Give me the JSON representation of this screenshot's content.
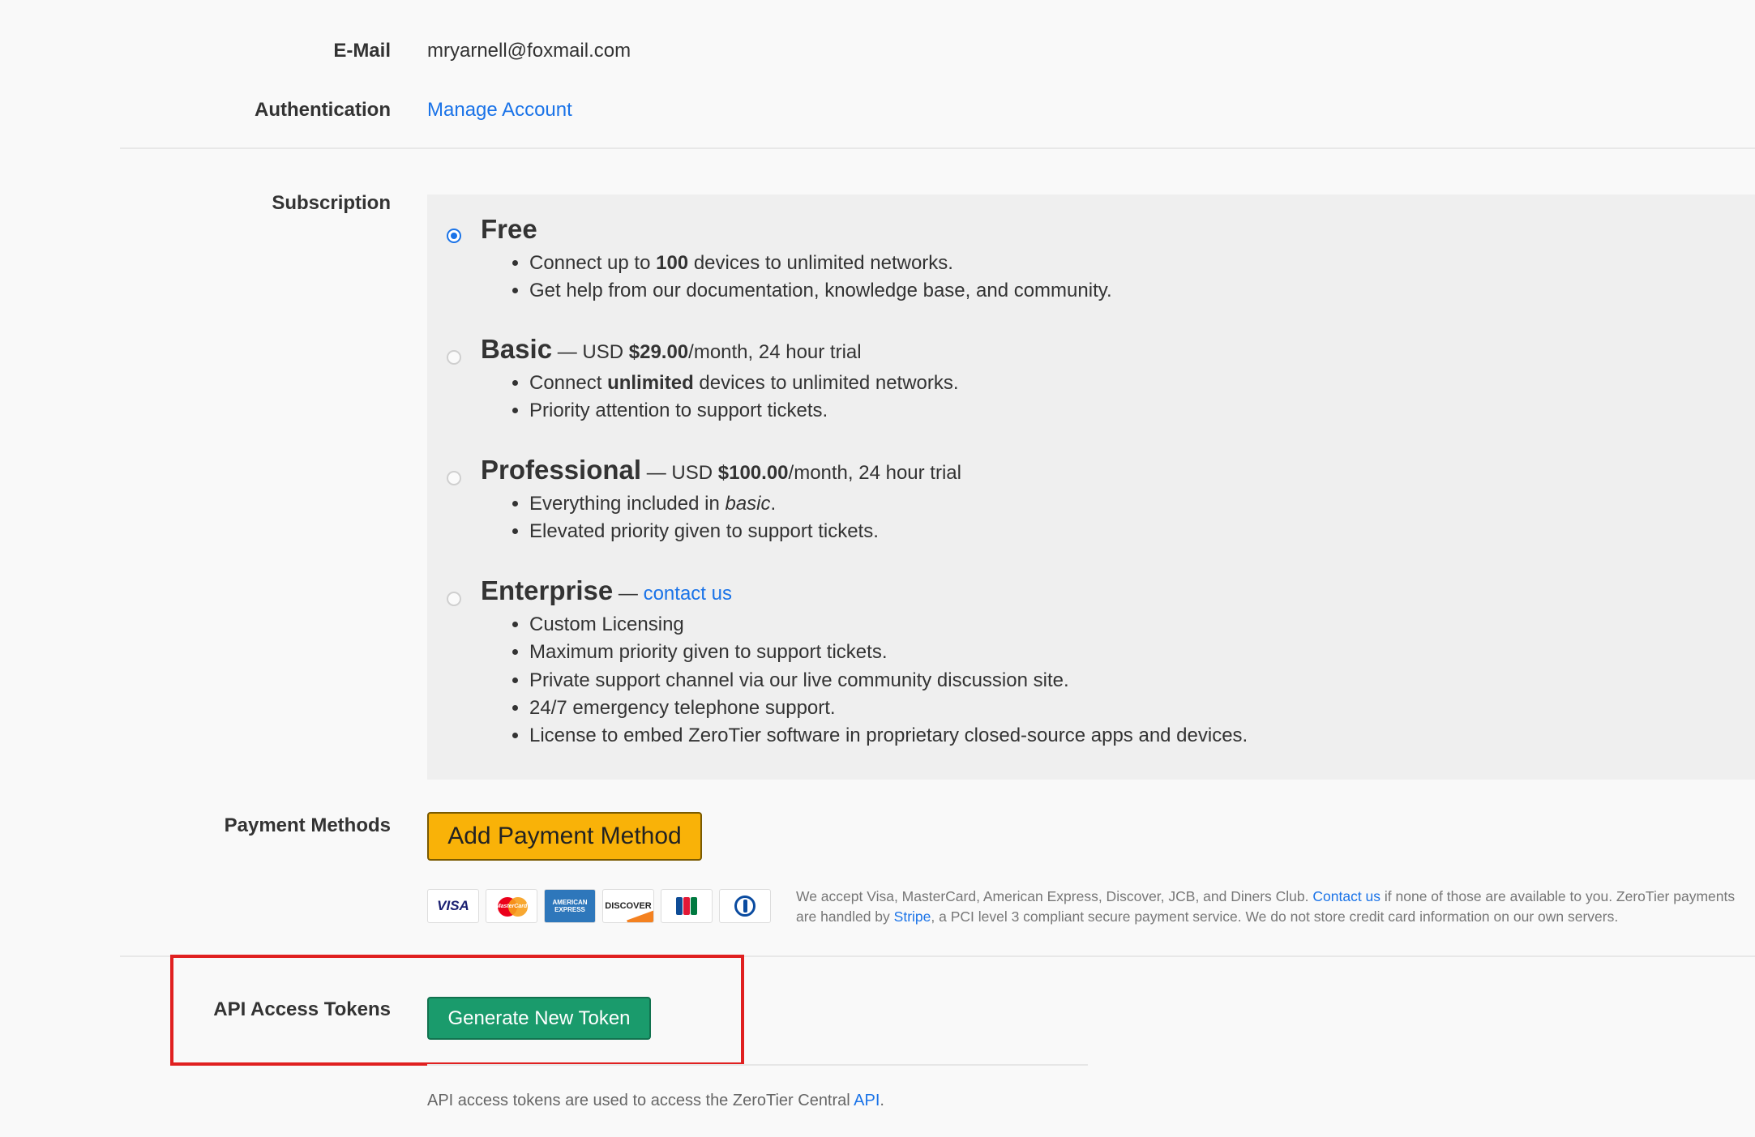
{
  "account": {
    "email_label": "E-Mail",
    "email_value": "mryarnell@foxmail.com",
    "auth_label": "Authentication",
    "auth_link": "Manage Account"
  },
  "subscription": {
    "label": "Subscription",
    "plans": [
      {
        "name": "Free",
        "selected": true,
        "price_prefix": "",
        "price": "",
        "price_suffix": "",
        "bullets": [
          {
            "pre": "Connect up to ",
            "bold": "100",
            "post": " devices to unlimited networks."
          },
          {
            "pre": "Get help from our documentation, knowledge base, and community.",
            "bold": "",
            "post": ""
          }
        ]
      },
      {
        "name": "Basic",
        "selected": false,
        "price_prefix": " — USD ",
        "price": "$29.00",
        "price_suffix": "/month, 24 hour trial",
        "bullets": [
          {
            "pre": "Connect ",
            "bold": "unlimited",
            "post": " devices to unlimited networks."
          },
          {
            "pre": "Priority attention to support tickets.",
            "bold": "",
            "post": ""
          }
        ]
      },
      {
        "name": "Professional",
        "selected": false,
        "price_prefix": " — USD ",
        "price": "$100.00",
        "price_suffix": "/month, 24 hour trial",
        "bullets": [
          {
            "pre": "Everything included in ",
            "italic": "basic",
            "post": "."
          },
          {
            "pre": "Elevated priority given to support tickets.",
            "bold": "",
            "post": ""
          }
        ]
      },
      {
        "name": "Enterprise",
        "selected": false,
        "dash": " — ",
        "link": "contact us",
        "bullets": [
          {
            "pre": "Custom Licensing"
          },
          {
            "pre": "Maximum priority given to support tickets."
          },
          {
            "pre": "Private support channel via our live community discussion site."
          },
          {
            "pre": "24/7 emergency telephone support."
          },
          {
            "pre": "License to embed ZeroTier software in proprietary closed-source apps and devices."
          }
        ]
      }
    ]
  },
  "payment": {
    "label": "Payment Methods",
    "add_button": "Add Payment Method",
    "cards": [
      "visa-logo",
      "mastercard-logo",
      "amex-logo",
      "discover-logo",
      "jcb-logo",
      "diners-logo"
    ],
    "card_texts": {
      "visa": "VISA",
      "mastercard": "MasterCard",
      "amex_line1": "AMERICAN",
      "amex_line2": "EXPRESS",
      "discover": "DISCOVER"
    },
    "accept_pre": "We accept Visa, MasterCard, American Express, Discover, JCB, and Diners Club. ",
    "accept_link": "Contact us",
    "accept_mid": " if none of those are available to you. ZeroTier payments are handled by ",
    "accept_link2": "Stripe",
    "accept_post": ", a PCI level 3 compliant secure payment service. We do not store credit card information on our own servers."
  },
  "api": {
    "label": "API Access Tokens",
    "button": "Generate New Token",
    "note_pre": "API access tokens are used to access the ZeroTier Central ",
    "note_link": "API",
    "note_post": "."
  },
  "colors": {
    "link": "#1a73e8",
    "add_button_bg": "#f9b208",
    "token_button_bg": "#1a9b6c",
    "highlight": "#e02020"
  }
}
